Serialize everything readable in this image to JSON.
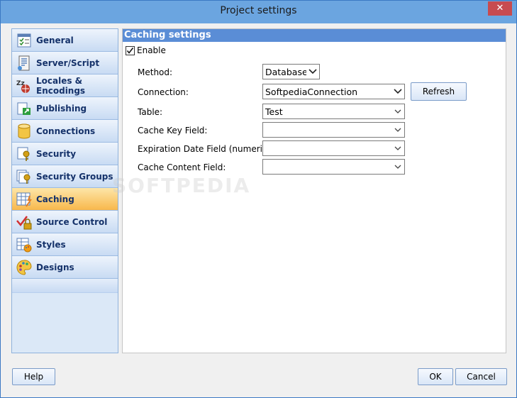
{
  "window": {
    "title": "Project settings",
    "close_glyph": "✕"
  },
  "sidebar": {
    "items": [
      {
        "label": "General",
        "icon": "checklist-icon",
        "active": false
      },
      {
        "label": "Server/Script",
        "icon": "server-script-icon",
        "active": false
      },
      {
        "label": "Locales & Encodings",
        "icon": "locales-icon",
        "active": false
      },
      {
        "label": "Publishing",
        "icon": "publishing-icon",
        "active": false
      },
      {
        "label": "Connections",
        "icon": "database-icon",
        "active": false
      },
      {
        "label": "Security",
        "icon": "security-icon",
        "active": false
      },
      {
        "label": "Security Groups",
        "icon": "security-groups-icon",
        "active": false
      },
      {
        "label": "Caching",
        "icon": "caching-icon",
        "active": true
      },
      {
        "label": "Source Control",
        "icon": "source-control-icon",
        "active": false
      },
      {
        "label": "Styles",
        "icon": "styles-icon",
        "active": false
      },
      {
        "label": "Designs",
        "icon": "palette-icon",
        "active": false
      }
    ]
  },
  "caching": {
    "header": "Caching settings",
    "enable_label": "Enable",
    "enable_checked": true,
    "method_label": "Method:",
    "method_value": "Database",
    "connection_label": "Connection:",
    "connection_value": "SoftpediaConnection",
    "refresh_label": "Refresh",
    "table_label": "Table:",
    "table_value": "Test",
    "cache_key_label": "Cache Key Field:",
    "cache_key_value": "",
    "expiration_label": "Expiration Date Field (numeric):",
    "expiration_value": "",
    "cache_content_label": "Cache Content Field:",
    "cache_content_value": ""
  },
  "watermark": "SOFTPEDIA",
  "footer": {
    "help_label": "Help",
    "ok_label": "OK",
    "cancel_label": "Cancel"
  },
  "colors": {
    "accent": "#5a8dd6",
    "active_item": "#f8b84c",
    "titlebar": "#6ba5e0",
    "close": "#c74b50"
  }
}
